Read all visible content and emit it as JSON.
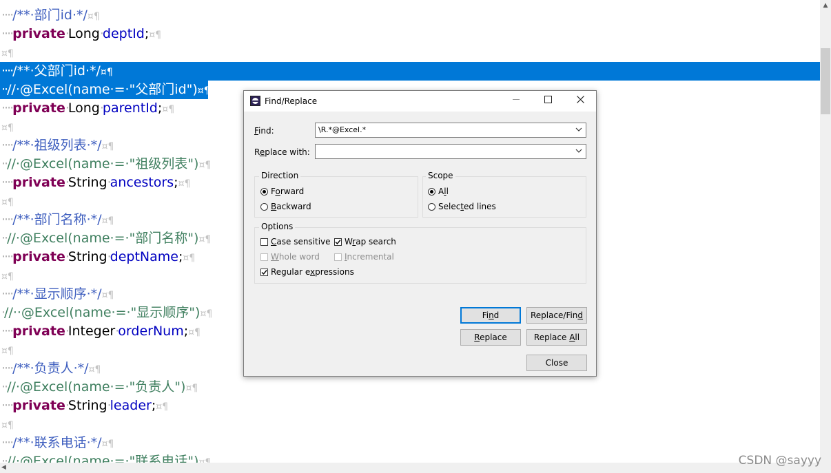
{
  "editor": {
    "lines": [
      {
        "indent": "····",
        "parts": [
          {
            "c": "cmt",
            "t": "/**·部门id·*/"
          }
        ],
        "pil": "¤¶"
      },
      {
        "indent": "····",
        "parts": [
          {
            "c": "kw",
            "t": "private"
          },
          {
            "c": "ws",
            "t": "·"
          },
          {
            "c": "ty",
            "t": "Long"
          },
          {
            "c": "ws",
            "t": "·"
          },
          {
            "c": "fld",
            "t": "deptId"
          },
          {
            "c": "ty",
            "t": ";"
          }
        ],
        "pil": "¤¶"
      },
      {
        "indent": "",
        "parts": [],
        "pil": "¤¶"
      },
      {
        "indent": "····",
        "parts": [
          {
            "c": "cmt",
            "t": "/**·父部门id·*/"
          }
        ],
        "pil": "¤¶",
        "selected": true
      },
      {
        "indent": "··",
        "parts": [
          {
            "c": "cmt2",
            "t": "//·@Excel(name·=·\"父部门id\")"
          }
        ],
        "pil": "¤¶",
        "selected_partial": true
      },
      {
        "indent": "····",
        "parts": [
          {
            "c": "kw",
            "t": "private"
          },
          {
            "c": "ws",
            "t": "·"
          },
          {
            "c": "ty",
            "t": "Long"
          },
          {
            "c": "ws",
            "t": "·"
          },
          {
            "c": "fld",
            "t": "parentId"
          },
          {
            "c": "ty",
            "t": ";"
          }
        ],
        "pil": "¤¶"
      },
      {
        "indent": "",
        "parts": [],
        "pil": "¤¶"
      },
      {
        "indent": "····",
        "parts": [
          {
            "c": "cmt",
            "t": "/**·祖级列表·*/"
          }
        ],
        "pil": "¤¶"
      },
      {
        "indent": "··",
        "parts": [
          {
            "c": "cmt2",
            "t": "//·@Excel(name·=·\"祖级列表\")"
          }
        ],
        "pil": "¤¶"
      },
      {
        "indent": "····",
        "parts": [
          {
            "c": "kw",
            "t": "private"
          },
          {
            "c": "ws",
            "t": "·"
          },
          {
            "c": "ty",
            "t": "String"
          },
          {
            "c": "ws",
            "t": "·"
          },
          {
            "c": "fld",
            "t": "ancestors"
          },
          {
            "c": "ty",
            "t": ";"
          }
        ],
        "pil": "¤¶"
      },
      {
        "indent": "",
        "parts": [],
        "pil": "¤¶"
      },
      {
        "indent": "····",
        "parts": [
          {
            "c": "cmt",
            "t": "/**·部门名称·*/"
          }
        ],
        "pil": "¤¶"
      },
      {
        "indent": "··",
        "parts": [
          {
            "c": "cmt2",
            "t": "//·@Excel(name·=·\"部门名称\")"
          }
        ],
        "pil": "¤¶"
      },
      {
        "indent": "····",
        "parts": [
          {
            "c": "kw",
            "t": "private"
          },
          {
            "c": "ws",
            "t": "·"
          },
          {
            "c": "ty",
            "t": "String"
          },
          {
            "c": "ws",
            "t": "·"
          },
          {
            "c": "fld",
            "t": "deptName"
          },
          {
            "c": "ty",
            "t": ";"
          }
        ],
        "pil": "¤¶"
      },
      {
        "indent": "",
        "parts": [],
        "pil": "¤¶"
      },
      {
        "indent": "····",
        "parts": [
          {
            "c": "cmt",
            "t": "/**·显示顺序·*/"
          }
        ],
        "pil": "¤¶"
      },
      {
        "indent": "·",
        "parts": [
          {
            "c": "cmt2",
            "t": "//··@Excel(name·=·\"显示顺序\")"
          }
        ],
        "pil": "¤¶"
      },
      {
        "indent": "····",
        "parts": [
          {
            "c": "kw",
            "t": "private"
          },
          {
            "c": "ws",
            "t": "·"
          },
          {
            "c": "ty",
            "t": "Integer"
          },
          {
            "c": "ws",
            "t": "·"
          },
          {
            "c": "fld",
            "t": "orderNum"
          },
          {
            "c": "ty",
            "t": ";"
          }
        ],
        "pil": "¤¶"
      },
      {
        "indent": "",
        "parts": [],
        "pil": "¤¶"
      },
      {
        "indent": "····",
        "parts": [
          {
            "c": "cmt",
            "t": "/**·负责人·*/"
          }
        ],
        "pil": "¤¶"
      },
      {
        "indent": "··",
        "parts": [
          {
            "c": "cmt2",
            "t": "//·@Excel(name·=·\"负责人\")"
          }
        ],
        "pil": "¤¶"
      },
      {
        "indent": "····",
        "parts": [
          {
            "c": "kw",
            "t": "private"
          },
          {
            "c": "ws",
            "t": "·"
          },
          {
            "c": "ty",
            "t": "String"
          },
          {
            "c": "ws",
            "t": "·"
          },
          {
            "c": "fld",
            "t": "leader"
          },
          {
            "c": "ty",
            "t": ";"
          }
        ],
        "pil": "¤¶"
      },
      {
        "indent": "",
        "parts": [],
        "pil": "¤¶"
      },
      {
        "indent": "····",
        "parts": [
          {
            "c": "cmt",
            "t": "/**·联系电话·*/"
          }
        ],
        "pil": "¤¶"
      },
      {
        "indent": "··",
        "parts": [
          {
            "c": "cmt2",
            "t": "//·@Excel(name·=·\"联系电话\")"
          }
        ],
        "pil": "¤¶"
      }
    ]
  },
  "dialog": {
    "title": "Find/Replace",
    "find_label": "Find:",
    "find_value": "\\R.*@Excel.*",
    "replace_label": "Replace with:",
    "replace_value": "",
    "direction": {
      "title": "Direction",
      "forward": "Forward",
      "backward": "Backward",
      "selected": "forward"
    },
    "scope": {
      "title": "Scope",
      "all": "All",
      "selected_lines": "Selected lines",
      "selected": "all"
    },
    "options": {
      "title": "Options",
      "case_sensitive": {
        "label": "Case sensitive",
        "checked": false,
        "enabled": true
      },
      "wrap_search": {
        "label": "Wrap search",
        "checked": true,
        "enabled": true
      },
      "whole_word": {
        "label": "Whole word",
        "checked": false,
        "enabled": false
      },
      "incremental": {
        "label": "Incremental",
        "checked": false,
        "enabled": false
      },
      "regular_expressions": {
        "label": "Regular expressions",
        "checked": true,
        "enabled": true
      }
    },
    "buttons": {
      "find": "Find",
      "replace_find": "Replace/Find",
      "replace": "Replace",
      "replace_all": "Replace All",
      "close": "Close"
    }
  },
  "watermark": "CSDN @sayyy"
}
